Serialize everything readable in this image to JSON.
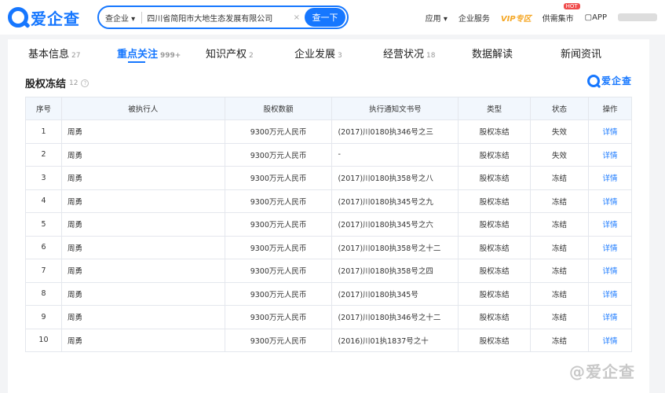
{
  "header": {
    "logo_text": "爱企查",
    "search_type": "查企业 ▾",
    "search_value": "四川省简阳市大地生态发展有限公司",
    "clear": "×",
    "search_button": "查一下",
    "nav": {
      "app": "应用 ▾",
      "service": "企业服务",
      "vip": "VIP专区",
      "market": "供需集市",
      "hot": "HOT",
      "app_download": "▢APP"
    }
  },
  "tabs": [
    {
      "label": "基本信息",
      "count": "27"
    },
    {
      "label": "重点关注",
      "count": "999+"
    },
    {
      "label": "知识产权",
      "count": "2"
    },
    {
      "label": "企业发展",
      "count": "3"
    },
    {
      "label": "经营状况",
      "count": "18"
    },
    {
      "label": "数据解读",
      "count": ""
    },
    {
      "label": "新闻资讯",
      "count": ""
    }
  ],
  "section": {
    "title": "股权冻结",
    "count": "12",
    "help": "?",
    "brand": "爱企查"
  },
  "table": {
    "headers": [
      "序号",
      "被执行人",
      "股权数额",
      "执行通知文书号",
      "类型",
      "状态",
      "操作"
    ],
    "rows": [
      [
        "1",
        "周勇",
        "9300万元人民币",
        "(2017)川0180执346号之三",
        "股权冻结",
        "失效",
        "详情"
      ],
      [
        "2",
        "周勇",
        "9300万元人民币",
        "-",
        "股权冻结",
        "失效",
        "详情"
      ],
      [
        "3",
        "周勇",
        "9300万元人民币",
        "(2017)川0180执358号之八",
        "股权冻结",
        "冻结",
        "详情"
      ],
      [
        "4",
        "周勇",
        "9300万元人民币",
        "(2017)川0180执345号之九",
        "股权冻结",
        "冻结",
        "详情"
      ],
      [
        "5",
        "周勇",
        "9300万元人民币",
        "(2017)川0180执345号之六",
        "股权冻结",
        "冻结",
        "详情"
      ],
      [
        "6",
        "周勇",
        "9300万元人民币",
        "(2017)川0180执358号之十二",
        "股权冻结",
        "冻结",
        "详情"
      ],
      [
        "7",
        "周勇",
        "9300万元人民币",
        "(2017)川0180执358号之四",
        "股权冻结",
        "冻结",
        "详情"
      ],
      [
        "8",
        "周勇",
        "9300万元人民币",
        "(2017)川0180执345号",
        "股权冻结",
        "冻结",
        "详情"
      ],
      [
        "9",
        "周勇",
        "9300万元人民币",
        "(2017)川0180执346号之十二",
        "股权冻结",
        "冻结",
        "详情"
      ],
      [
        "10",
        "周勇",
        "9300万元人民币",
        "(2016)川01执1837号之十",
        "股权冻结",
        "冻结",
        "详情"
      ]
    ]
  },
  "watermark": "@爱企查",
  "colors": {
    "accent": "#1677ff",
    "vip": "#f5a623",
    "hot": "#f04d4d"
  }
}
